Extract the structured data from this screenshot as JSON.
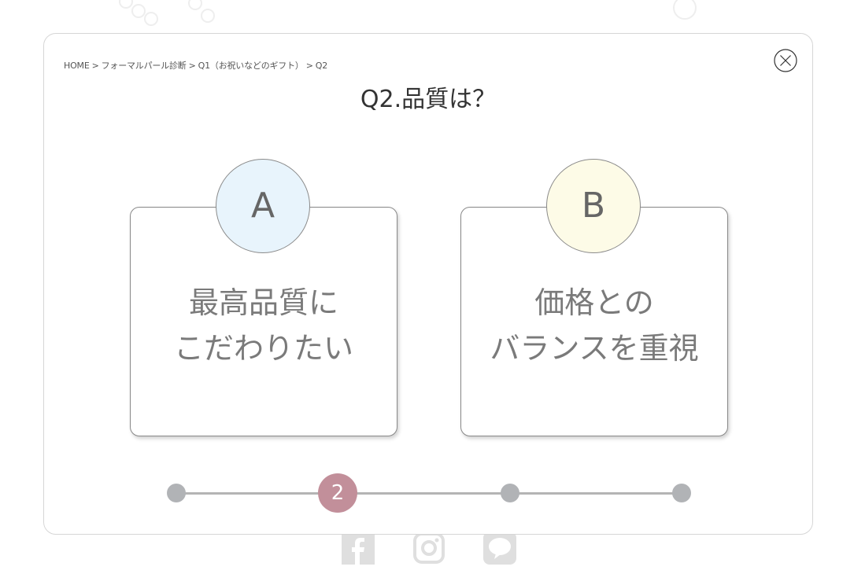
{
  "breadcrumb": {
    "items": [
      "HOME",
      "フォーマルパール診断",
      "Q1（お祝いなどのギフト）",
      "Q2"
    ],
    "separator": ">"
  },
  "question": {
    "title": "Q2.品質は？"
  },
  "options": [
    {
      "badge": "A",
      "line1": "最高品質に",
      "line2": "こだわりたい",
      "badge_color": "#e8f4fc"
    },
    {
      "badge": "B",
      "line1": "価格との",
      "line2": "バランスを重視",
      "badge_color": "#fdfbe7"
    }
  ],
  "progress": {
    "total_steps": 4,
    "current_step": 2,
    "current_label": "2",
    "active_color": "#c28f9a",
    "inactive_color": "#b1b3b6"
  },
  "icons": {
    "close": "close-icon",
    "social": [
      "facebook-icon",
      "instagram-icon",
      "line-icon"
    ]
  }
}
